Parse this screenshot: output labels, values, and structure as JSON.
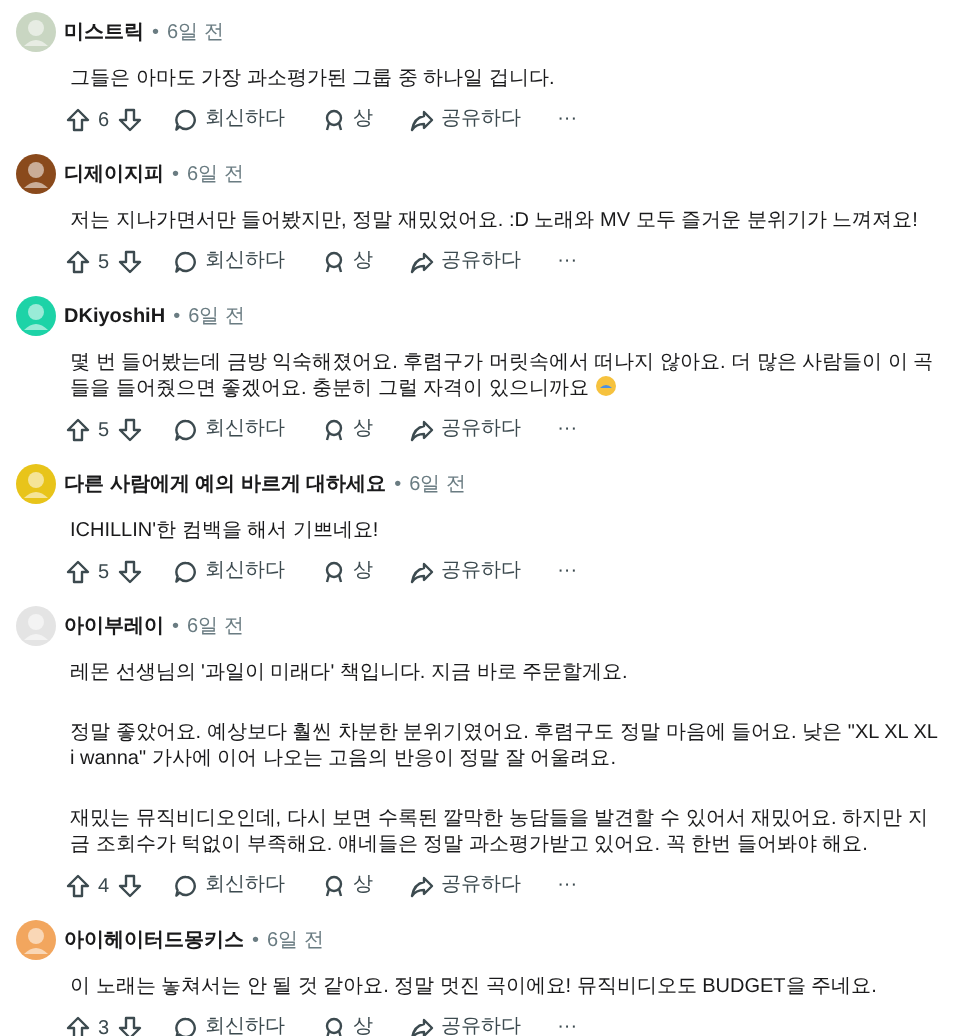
{
  "comments": [
    {
      "author": "미스트릭",
      "sep": "•",
      "time": "6일 전",
      "color": "#c9d6c2",
      "paragraphs": [
        "그들은 아마도 가장 과소평가된 그룹 중 하나일 겁니다."
      ],
      "emoji": false,
      "votes": "6",
      "reply": "회신하다",
      "award": "상",
      "share": "공유하다",
      "more": "···"
    },
    {
      "author": "디제이지피",
      "sep": "•",
      "time": "6일 전",
      "color": "#8a4a1c",
      "paragraphs": [
        "저는 지나가면서만 들어봤지만, 정말 재밌었어요. :D 노래와 MV 모두 즐거운 분위기가 느껴져요!"
      ],
      "emoji": false,
      "votes": "5",
      "reply": "회신하다",
      "award": "상",
      "share": "공유하다",
      "more": "···"
    },
    {
      "author": "DKiyoshiH",
      "sep": "•",
      "time": "6일 전",
      "color": "#1dd3a7",
      "paragraphs": [
        "몇 번 들어봤는데 금방 익숙해졌어요. 후렴구가 머릿속에서 떠나지 않아요. 더 많은 사람들이 이 곡들을 들어줬으면 좋겠어요. 충분히 그럴 자격이 있으니까요"
      ],
      "emoji": true,
      "votes": "5",
      "reply": "회신하다",
      "award": "상",
      "share": "공유하다",
      "more": "···"
    },
    {
      "author": "다른 사람에게 예의 바르게 대하세요",
      "sep": "•",
      "time": "6일 전",
      "color": "#e8c41a",
      "paragraphs": [
        "ICHILLIN'한 컴백을 해서 기쁘네요!"
      ],
      "emoji": false,
      "votes": "5",
      "reply": "회신하다",
      "award": "상",
      "share": "공유하다",
      "more": "···"
    },
    {
      "author": "아이부레이",
      "sep": "•",
      "time": "6일 전",
      "color": "#e4e4e4",
      "paragraphs": [
        "레몬 선생님의 '과일이 미래다' 책입니다. 지금 바로 주문할게요.",
        "정말 좋았어요. 예상보다 훨씬 차분한 분위기였어요. 후렴구도 정말 마음에 들어요. 낮은 \"XL XL XL i wanna\" 가사에 이어 나오는 고음의 반응이 정말 잘 어울려요.",
        "재밌는 뮤직비디오인데, 다시 보면 수록된 깔막한 농담들을 발견할 수 있어서 재밌어요. 하지만 지금 조회수가 턱없이 부족해요. 얘네들은 정말 과소평가받고 있어요. 꼭 한번 들어봐야 해요."
      ],
      "emoji": false,
      "votes": "4",
      "reply": "회신하다",
      "award": "상",
      "share": "공유하다",
      "more": "···"
    },
    {
      "author": "아이헤이터드몽키스",
      "sep": "•",
      "time": "6일 전",
      "color": "#f2a65e",
      "paragraphs": [
        "이 노래는 놓쳐서는 안 될 것 같아요. 정말 멋진 곡이에요! 뮤직비디오도 BUDGET을 주네요."
      ],
      "emoji": false,
      "votes": "3",
      "reply": "회신하다",
      "award": "상",
      "share": "공유하다",
      "more": "···"
    }
  ]
}
